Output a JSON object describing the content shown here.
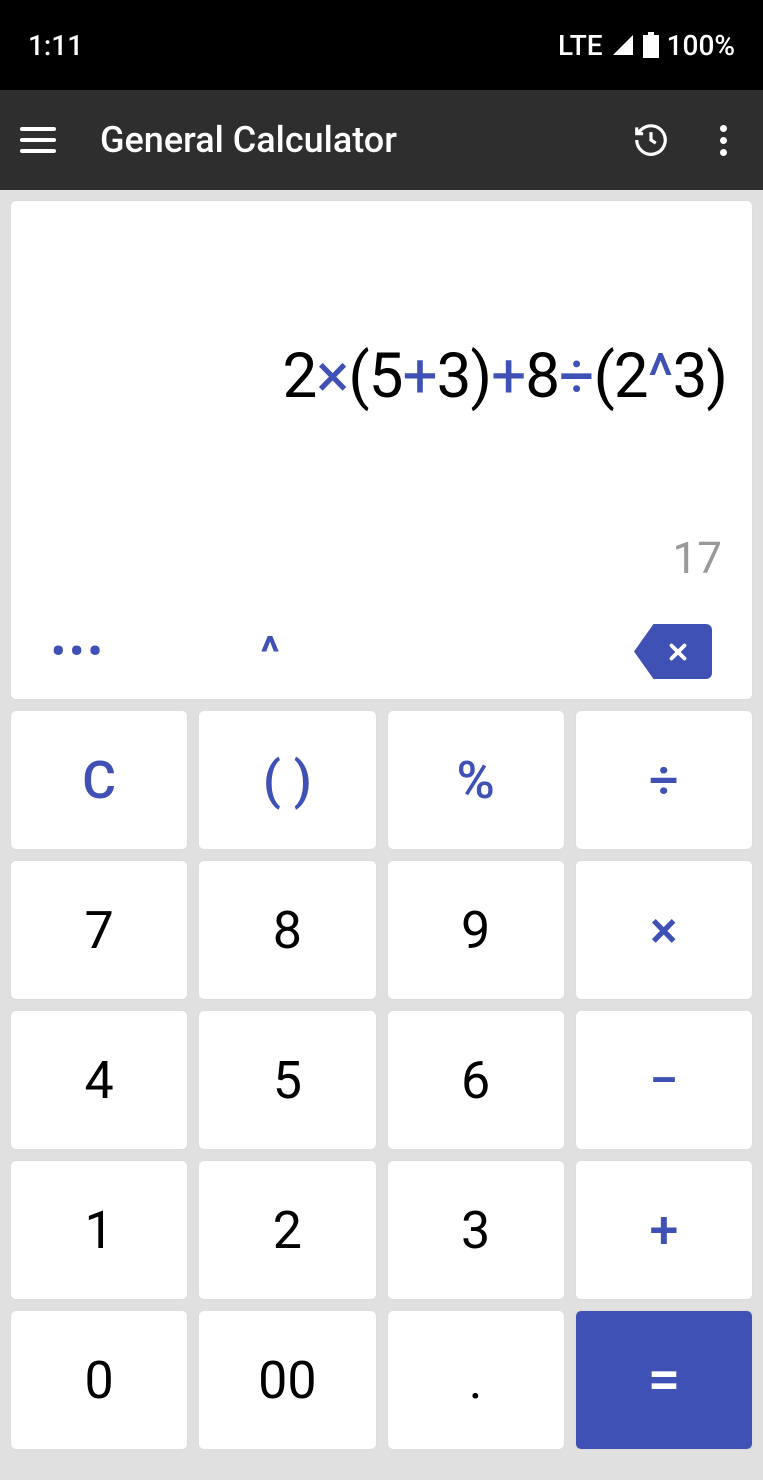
{
  "status": {
    "time": "1:11",
    "network": "LTE",
    "battery": "100%"
  },
  "header": {
    "title": "General Calculator"
  },
  "display": {
    "expression_tokens": [
      {
        "t": "2",
        "c": "num"
      },
      {
        "t": "×",
        "c": "op"
      },
      {
        "t": "(5",
        "c": "num"
      },
      {
        "t": "+",
        "c": "op"
      },
      {
        "t": "3)",
        "c": "num"
      },
      {
        "t": "+",
        "c": "op"
      },
      {
        "t": "8",
        "c": "num"
      },
      {
        "t": "÷",
        "c": "op"
      },
      {
        "t": "(2",
        "c": "num"
      },
      {
        "t": "^",
        "c": "op"
      },
      {
        "t": "3)",
        "c": "num"
      }
    ],
    "result": "17",
    "caret_label": "^",
    "more_dots": "•••"
  },
  "keys": {
    "clear": "C",
    "parens": "( )",
    "percent": "%",
    "divide": "÷",
    "k7": "7",
    "k8": "8",
    "k9": "9",
    "multiply": "×",
    "k4": "4",
    "k5": "5",
    "k6": "6",
    "minus": "−",
    "k1": "1",
    "k2": "2",
    "k3": "3",
    "plus": "+",
    "k0": "0",
    "k00": "00",
    "dot": ".",
    "equals": "="
  }
}
